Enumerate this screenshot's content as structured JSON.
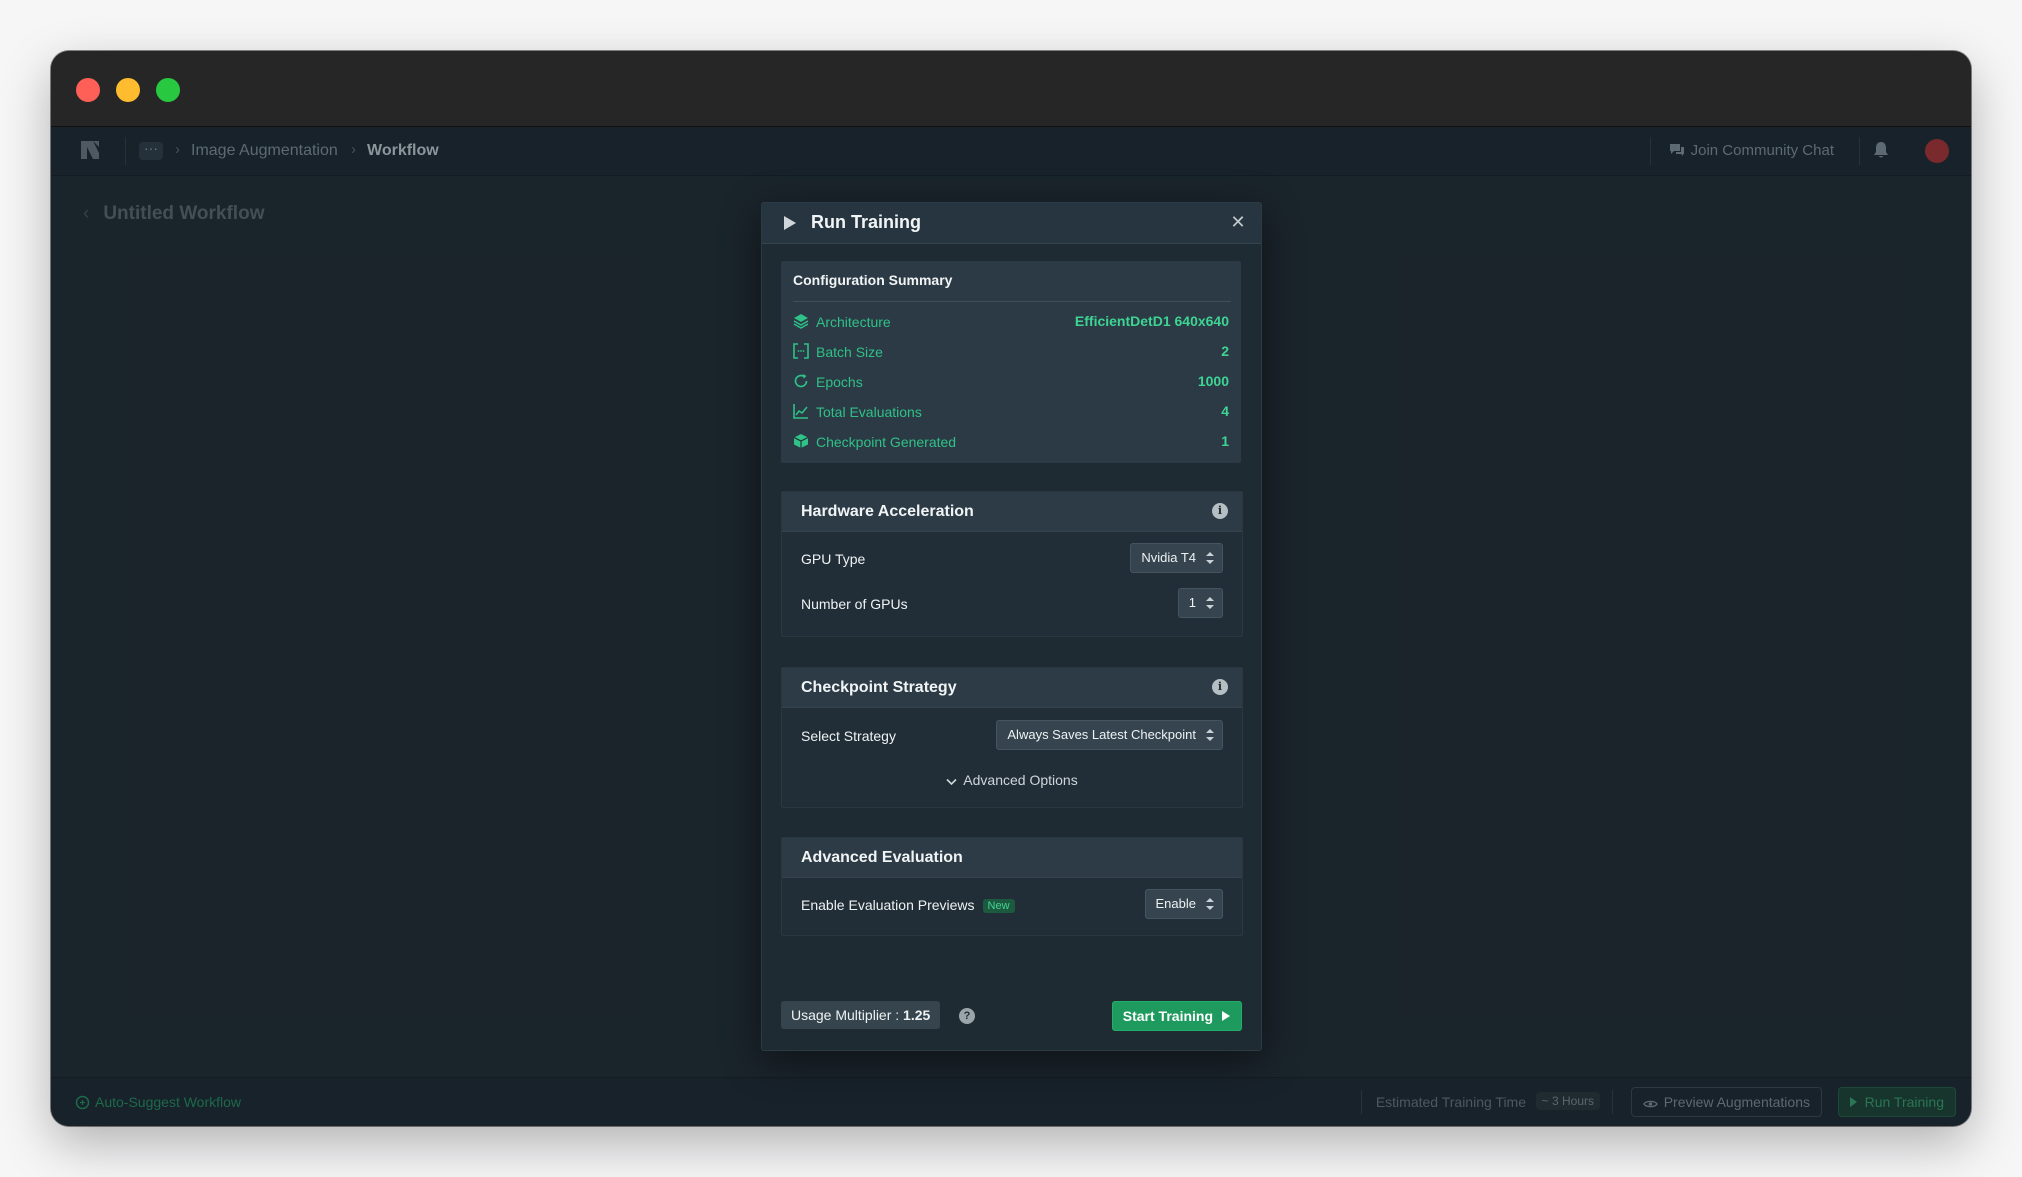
{
  "appbar": {
    "crumbs": [
      "Image Augmentation",
      "Workflow"
    ],
    "community": "Join Community Chat"
  },
  "page": {
    "workflow_title": "Untitled Workflow"
  },
  "modal": {
    "title": "Run Training",
    "summary": {
      "title": "Configuration Summary",
      "rows": [
        {
          "label": "Architecture",
          "value": "EfficientDetD1 640x640",
          "icon": "layers-icon"
        },
        {
          "label": "Batch Size",
          "value": "2",
          "icon": "brackets-icon"
        },
        {
          "label": "Epochs",
          "value": "1000",
          "icon": "refresh-icon"
        },
        {
          "label": "Total Evaluations",
          "value": "4",
          "icon": "chart-icon"
        },
        {
          "label": "Checkpoint Generated",
          "value": "1",
          "icon": "cube-icon"
        }
      ]
    },
    "hardware": {
      "title": "Hardware Acceleration",
      "gpu_type_label": "GPU Type",
      "gpu_type_value": "Nvidia T4",
      "num_gpus_label": "Number of GPUs",
      "num_gpus_value": "1"
    },
    "checkpoint": {
      "title": "Checkpoint Strategy",
      "strategy_label": "Select Strategy",
      "strategy_value": "Always Saves Latest Checkpoint",
      "advanced_options": "Advanced Options"
    },
    "evaluation": {
      "title": "Advanced Evaluation",
      "previews_label": "Enable Evaluation Previews",
      "new_badge": "New",
      "previews_value": "Enable"
    },
    "usage_label": "Usage Multiplier :",
    "usage_value": "1.25",
    "start_label": "Start Training"
  },
  "bottombar": {
    "autosuggest": "Auto-Suggest Workflow",
    "estimated_label": "Estimated Training Time",
    "estimated_value": "~ 3 Hours",
    "preview": "Preview Augmentations",
    "run": "Run Training"
  },
  "colors": {
    "accent_green": "#3ed493",
    "button_green": "#1f9a5e",
    "modal_bg": "#1f2b33"
  }
}
